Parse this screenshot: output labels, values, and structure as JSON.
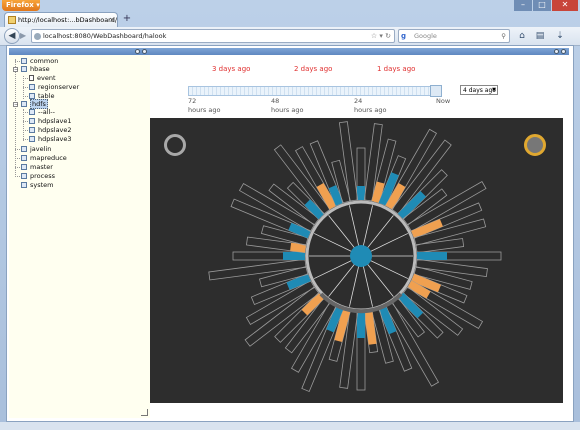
{
  "browser": {
    "menu_button": "Firefox",
    "tab_title": "http://localhost:...bDashboard/halook",
    "new_tab_symbol": "+",
    "url": "localhost:8080/WebDashboard/halook",
    "search_placeholder": "Google"
  },
  "tree": {
    "items": [
      {
        "label": "common"
      },
      {
        "label": "hbase"
      },
      {
        "label": "event"
      },
      {
        "label": "regionserver"
      },
      {
        "label": "table"
      },
      {
        "label": "hdfs"
      },
      {
        "label": "--all--"
      },
      {
        "label": "hdpslave1"
      },
      {
        "label": "hdpslave2"
      },
      {
        "label": "hdpslave3"
      },
      {
        "label": "javelin"
      },
      {
        "label": "mapreduce"
      },
      {
        "label": "master"
      },
      {
        "label": "process"
      },
      {
        "label": "system"
      }
    ]
  },
  "timeline": {
    "markers": [
      "3 days ago",
      "2 days ago",
      "1 days ago"
    ],
    "axis": [
      {
        "num": "72",
        "unit": "hours ago"
      },
      {
        "num": "48",
        "unit": "hours ago"
      },
      {
        "num": "24",
        "unit": "hours ago"
      },
      {
        "num": "Now",
        "unit": ""
      }
    ],
    "range_select": "4 days ago"
  },
  "colors": {
    "blue": "#1f8bb5",
    "orange": "#f0a050",
    "outline": "#9a9a9a",
    "background": "#2d2d2d"
  }
}
